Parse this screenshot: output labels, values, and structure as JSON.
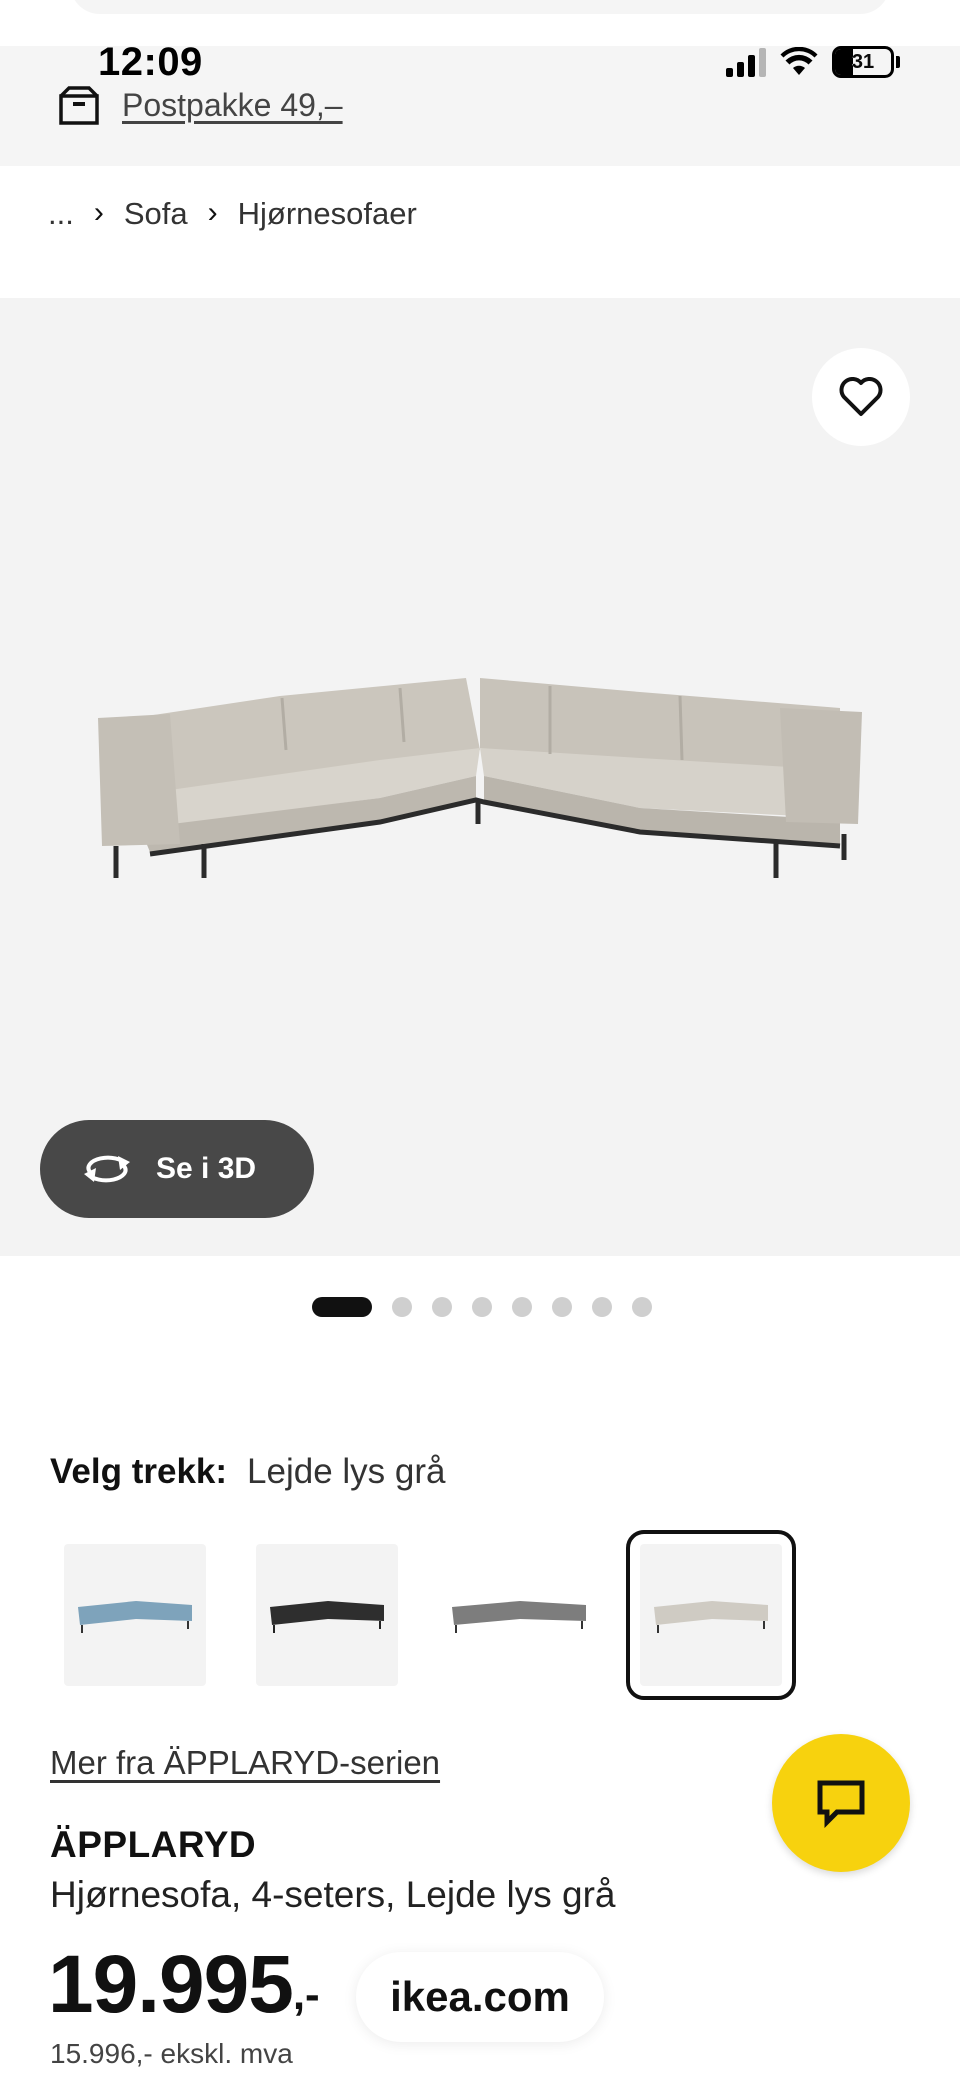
{
  "status_bar": {
    "time": "12:09",
    "battery": "31",
    "icons": [
      "signal-icon",
      "wifi-icon",
      "battery-icon"
    ]
  },
  "delivery": {
    "icon": "package-icon",
    "label": "Postpakke 49,–"
  },
  "breadcrumb": {
    "items": [
      "...",
      "Sofa",
      "Hjørnesofaer"
    ],
    "separator": "›"
  },
  "hero": {
    "favorite_icon": "heart-icon",
    "view_3d_label": "Se i 3D",
    "view_3d_icon": "rotate-3d-icon",
    "dots_total": 8,
    "dots_active_index": 0
  },
  "variant": {
    "label": "Velg trekk:",
    "selected": "Lejde lys grå",
    "swatch_colors": [
      "#7ea3bb",
      "#2e2e2e",
      "#7d7d7d",
      "#cfcbc3"
    ],
    "selected_index": 3
  },
  "series_link": "Mer fra ÄPPLARYD-serien",
  "chat_icon": "chat-icon",
  "product": {
    "name": "ÄPPLARYD",
    "description": "Hjørnesofa, 4-seters, Lejde lys grå",
    "price_main": "19.995",
    "price_suffix": ",-",
    "price_ex_vat": "15.996,- ekskl. mva"
  },
  "url_pill": "ikea.com",
  "colors": {
    "chat_button": "#f7d20e",
    "hero_bg": "#f3f3f3",
    "pill_3d": "#484848"
  }
}
